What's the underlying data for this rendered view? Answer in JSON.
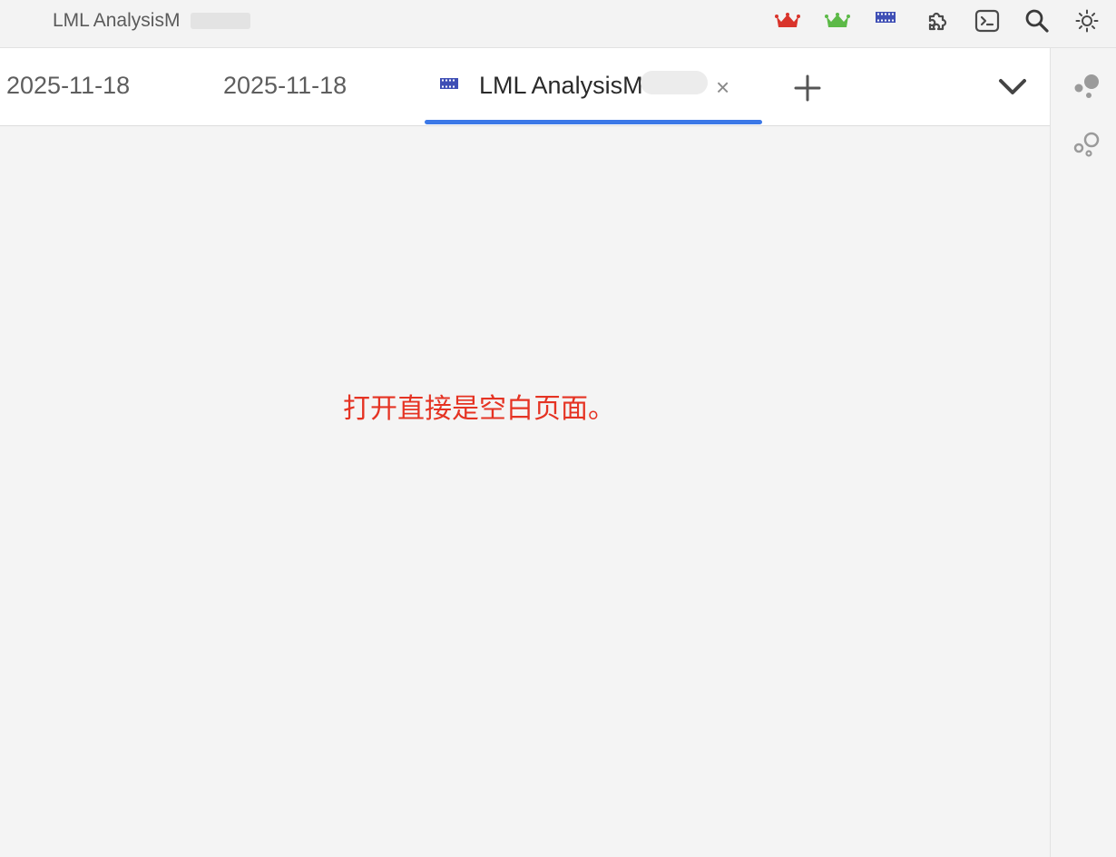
{
  "titlebar": {
    "title": "LML AnalysisM",
    "icons": [
      "crown-red-icon",
      "crown-green-icon",
      "film-icon",
      "puzzle-icon",
      "terminal-icon",
      "search-icon",
      "brightness-icon"
    ]
  },
  "tabs": [
    {
      "label": "2025-11-18",
      "active": false
    },
    {
      "label": "2025-11-18",
      "active": false
    },
    {
      "label": "LML AnalysisM",
      "active": true,
      "icon": "film-icon",
      "close": "×"
    }
  ],
  "tabstrip": {
    "new_tab_label": "+",
    "dropdown_icon": "chevron-down-icon"
  },
  "right_panel": {
    "icons": [
      "bubbles-filled-icon",
      "bubbles-outline-icon"
    ]
  },
  "content": {
    "annotation": "打开直接是空白页面。"
  },
  "colors": {
    "accent": "#3b78e7",
    "annotation": "#e53323",
    "crown_red": "#d9342b",
    "crown_green": "#5cb947",
    "film_blue": "#3f4fb5"
  }
}
